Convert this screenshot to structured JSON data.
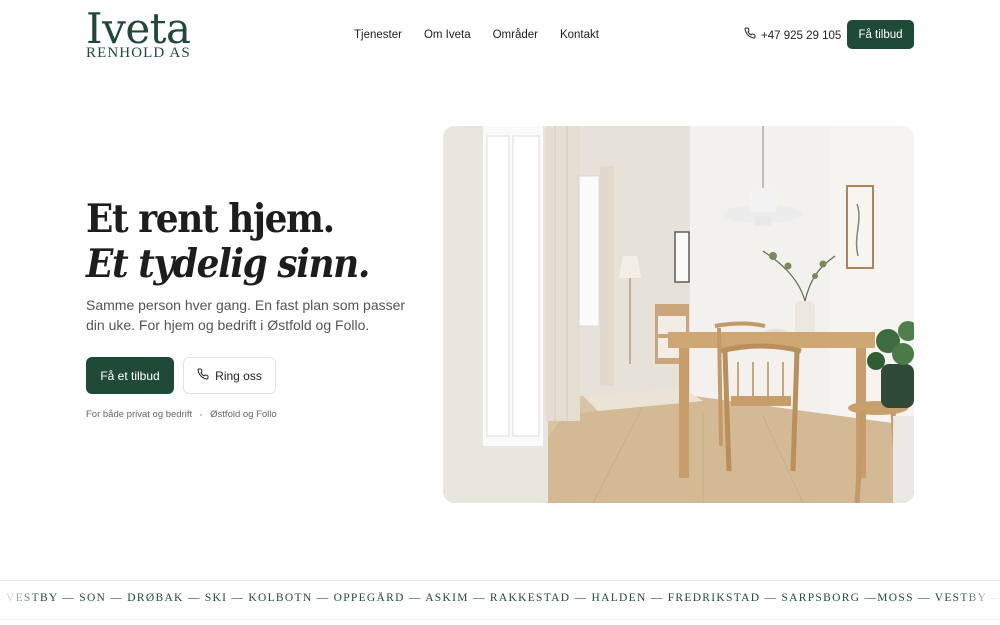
{
  "brand": {
    "name": "Iveta",
    "subtitle": "RENHOLD AS",
    "color": "#1f4a38"
  },
  "nav": {
    "items": [
      "Tjenester",
      "Om Iveta",
      "Områder",
      "Kontakt"
    ]
  },
  "header": {
    "phone": "+47 925 29 105",
    "phone_icon": "phone-icon",
    "cta_label": "Få tilbud"
  },
  "hero": {
    "headline_line1": "Et rent hjem.",
    "headline_line2": "Et tydelig sinn.",
    "subtext": "Samme person hver gang. En fast plan som passer din uke. For hjem og bedrift i Østfold og Follo.",
    "primary_cta": "Få et tilbud",
    "secondary_cta": "Ring oss",
    "tags": [
      "For både privat og bedrift",
      "Østfold og Follo"
    ]
  },
  "ticker": {
    "text": "VESTBY — SON — DRØBAK — SKI — KOLBOTN — OPPEGÅRD — ASKIM — RAKKESTAD — HALDEN — FREDRIKSTAD — SARPSBORG —MOSS — VESTBY — SON — DRØBAK — SKI"
  }
}
